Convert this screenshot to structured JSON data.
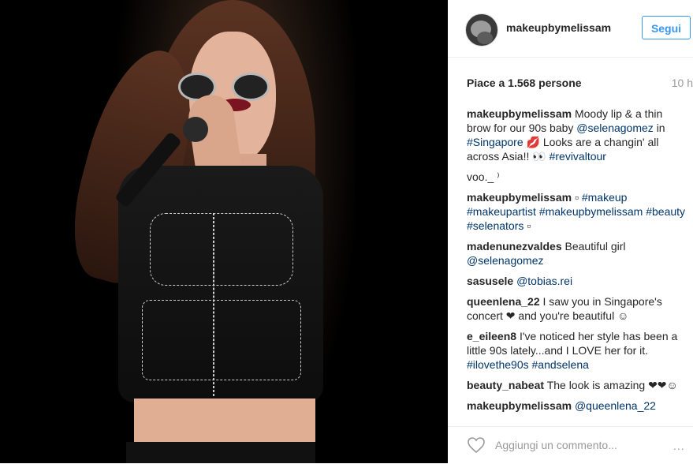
{
  "header": {
    "username": "makeupbymelissam",
    "follow_label": "Segui"
  },
  "post": {
    "likes": "Piace a 1.568 persone",
    "time": "10 h"
  },
  "comments": [
    {
      "user": "makeupbymelissam",
      "text": "Moody lip & a thin brow for our 90s baby",
      "mention": "@selenagomez",
      "after": "in",
      "tag1": "#Singapore",
      "emoji": "💋",
      "text2": "Looks are a changin' all across Asia!! 👀",
      "tag2": "#revivaltour"
    },
    {
      "user": "",
      "text": "voo._ ⁾"
    },
    {
      "user": "makeupbymelissam",
      "text": "▫",
      "tags": "#makeup #makeupartist #makeupbymelissam #beauty #selenators",
      "end": "▫"
    },
    {
      "user": "madenunezvaldes",
      "text": "Beautiful girl",
      "mention": "@selenagomez"
    },
    {
      "user": "sasusele",
      "mention": "@tobias.rei"
    },
    {
      "user": "queenlena_22",
      "text": "I saw you in Singapore's concert ❤ and you're beautiful ☺"
    },
    {
      "user": "e_eileen8",
      "text": "I've noticed her style has been a little 90s lately...and I LOVE her for it.",
      "tags": "#ilovethe90s #andselena"
    },
    {
      "user": "beauty_nabeat",
      "text": "The look is amazing ❤❤☺"
    },
    {
      "user": "makeupbymelissam",
      "mention": "@queenlena_22"
    }
  ],
  "footer": {
    "add_comment_placeholder": "Aggiungi un commento...",
    "more": "..."
  },
  "colors": {
    "accent": "#3897f0",
    "hashtag": "#003569",
    "text": "#262626",
    "muted": "#999999"
  },
  "icons": [
    "heart-icon",
    "more-options-icon"
  ]
}
